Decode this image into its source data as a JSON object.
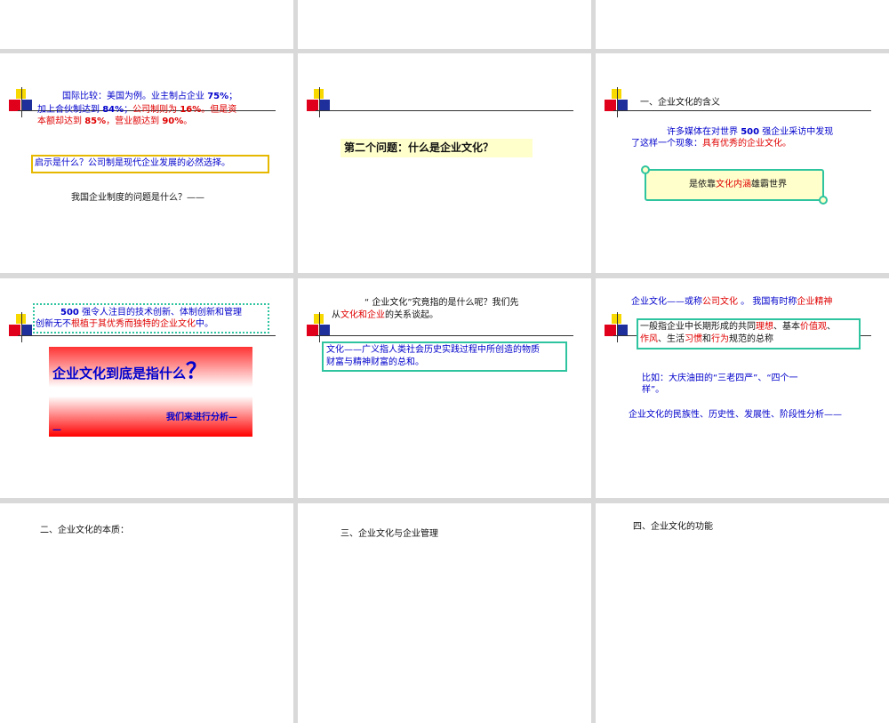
{
  "slides": {
    "s4": {
      "line1": {
        "a": "国际比较：美国为例。业主制占企业 ",
        "b": "75%",
        "c": "；"
      },
      "line2": {
        "a": "加上合伙制达到 ",
        "b": "84%",
        "c": "；",
        "d": "公司制则为 ",
        "e": "16%",
        "f": "。但是资"
      },
      "line3": {
        "a": "本额却达到 ",
        "b": "85%",
        "c": "，营业额达到 ",
        "d": "90%",
        "e": "。"
      },
      "box": "启示是什么？公司制是现代企业发展的必然选择。",
      "question": "我国企业制度的问题是什么？——"
    },
    "s5": {
      "title": "第二个问题：什么是企业文化？"
    },
    "s6": {
      "heading": "一、企业文化的含义",
      "line1": {
        "a": "许多媒体在对世界 ",
        "b": "500",
        "c": " 强企业采访中发现"
      },
      "line2": {
        "a": "了这样一个现象：",
        "b": "具有优秀的企业文化。"
      },
      "scroll": {
        "a": "是依靠",
        "b": "文化内涵",
        "c": "雄霸世界"
      }
    },
    "s7": {
      "line1": {
        "a": "500",
        "b": " 强令人注目的技术创新、体制创新和管理"
      },
      "line2": {
        "a": "创新无不",
        "b": "根植于其优秀而独特的企业文化",
        "c": "中。"
      },
      "big": "企业文化到底是指什么",
      "big_q": "？",
      "analysis": "我们来进行分析—",
      "analysis_cont": "—"
    },
    "s8": {
      "line1": "“ 企业文化”究竟指的是什么呢？我们先",
      "line2": {
        "a": "从",
        "b": "文化和企业",
        "c": "的关系谈起。"
      },
      "box1": "文化——广义指人类社会历史实践过程中所创造的物质",
      "box2": "财富与精神财富的总和。"
    },
    "s9": {
      "line1": {
        "a": "企业文化——或称",
        "b": "公司文化",
        "c": " 。 我国有时称",
        "d": "企业精神"
      },
      "box1": {
        "a": "一般指企业中长期形成的共同",
        "b": "理想",
        "c": "、基本",
        "d": "价值观",
        "e": "、"
      },
      "box2": {
        "a": "作风",
        "b": "、生活",
        "c": "习惯",
        "d": "和",
        "e": "行为",
        "f": "规范的总称"
      },
      "ex1": "比如：大庆油田的“三老四严”、“四个一",
      "ex2": "样”。",
      "bottom": "企业文化的民族性、历史性、发展性、阶段性分析——"
    },
    "s10": {
      "title": "二、企业文化的本质："
    },
    "s11": {
      "title": "三、企业文化与企业管理"
    },
    "s12": {
      "title": "四、企业文化的功能"
    }
  },
  "colors": {
    "blue": "#0000cc",
    "red": "#e00000",
    "gold": "#e6b800",
    "green": "#2fc4a0",
    "yellow": "#f7d900"
  }
}
